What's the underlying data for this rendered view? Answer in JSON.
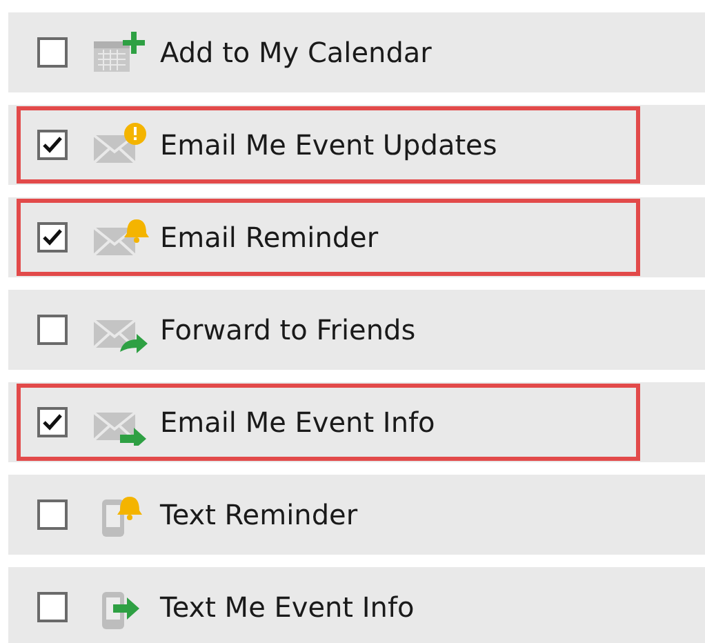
{
  "options": [
    {
      "label": "Add to My Calendar",
      "kind": "calendar-add",
      "checked": false,
      "highlighted": false
    },
    {
      "label": "Email Me Event Updates",
      "kind": "mail-alert",
      "checked": true,
      "highlighted": true
    },
    {
      "label": "Email Reminder",
      "kind": "mail-bell",
      "checked": true,
      "highlighted": true
    },
    {
      "label": "Forward to Friends",
      "kind": "mail-forward",
      "checked": false,
      "highlighted": false
    },
    {
      "label": "Email Me Event Info",
      "kind": "mail-arrow",
      "checked": true,
      "highlighted": true
    },
    {
      "label": "Text Reminder",
      "kind": "phone-bell",
      "checked": false,
      "highlighted": false
    },
    {
      "label": "Text Me Event Info",
      "kind": "phone-arrow",
      "checked": false,
      "highlighted": false
    }
  ]
}
